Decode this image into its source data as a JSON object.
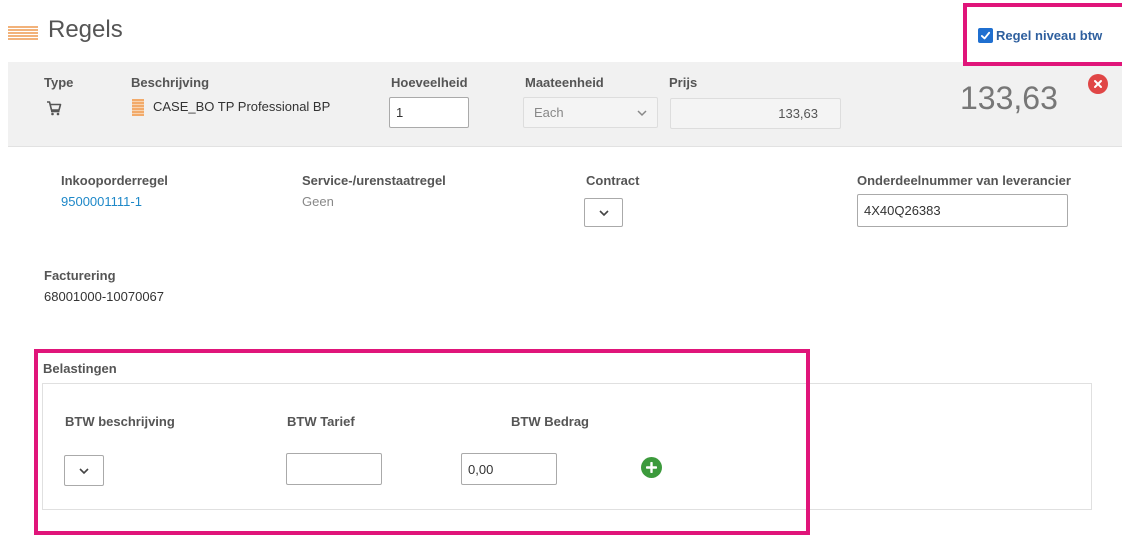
{
  "header": {
    "title": "Regels",
    "btw_toggle": {
      "label": "Regel niveau btw",
      "checked": true
    }
  },
  "line_item": {
    "type_label": "Type",
    "description_label": "Beschrijving",
    "description_value": "CASE_BO TP Professional BP",
    "quantity_label": "Hoeveelheid",
    "quantity_value": "1",
    "unit_label": "Maateenheid",
    "unit_value": "Each",
    "price_label": "Prijs",
    "price_value": "133,63",
    "total": "133,63"
  },
  "details": {
    "po_line_label": "Inkooporderregel",
    "po_line_value": "9500001111-1",
    "service_label": "Service-/urenstaatregel",
    "service_value": "Geen",
    "contract_label": "Contract",
    "supplier_part_label": "Onderdeelnummer van leverancier",
    "supplier_part_value": "4X40Q26383",
    "billing_label": "Facturering",
    "billing_value": "68001000-10070067"
  },
  "taxes": {
    "section_label": "Belastingen",
    "desc_label": "BTW beschrijving",
    "rate_label": "BTW Tarief",
    "rate_value": "",
    "amount_label": "BTW Bedrag",
    "amount_value": "0,00"
  },
  "colors": {
    "highlight": "#e0157a",
    "link": "#1e88c8",
    "delete": "#e04646",
    "add": "#3c9a3c",
    "checkbox": "#1f6fd0"
  }
}
